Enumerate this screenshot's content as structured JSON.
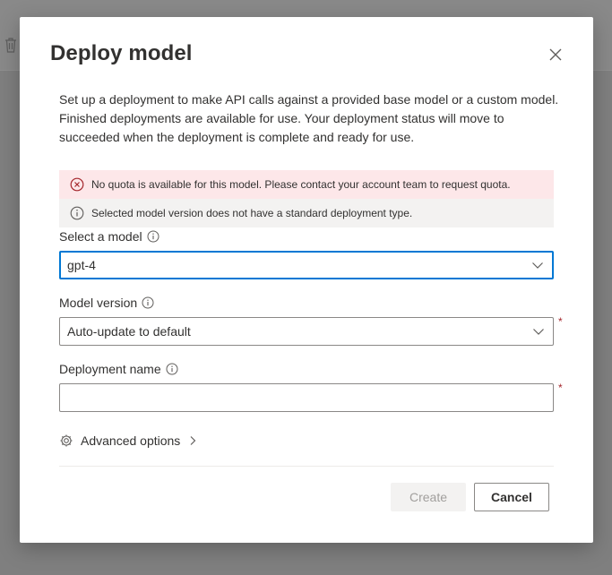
{
  "dialog": {
    "title": "Deploy model",
    "description": "Set up a deployment to make API calls against a provided base model or a custom model. Finished deployments are available for use. Your deployment status will move to succeeded when the deployment is complete and ready for use."
  },
  "messages": {
    "error": "No quota is available for this model. Please contact your account team to request quota.",
    "info": "Selected model version does not have a standard deployment type."
  },
  "form": {
    "model_label": "Select a model",
    "model_value": "gpt-4",
    "version_label": "Model version",
    "version_value": "Auto-update to default",
    "name_label": "Deployment name",
    "name_value": "",
    "required_marker": "*"
  },
  "advanced": {
    "label": "Advanced options"
  },
  "footer": {
    "create_label": "Create",
    "cancel_label": "Cancel"
  },
  "colors": {
    "accent": "#0078d4",
    "error_bg": "#fde7e9",
    "error_icon": "#a4262c",
    "info_bg": "#f3f2f1",
    "overlay": "#7f7f7f"
  },
  "icons": {
    "close": "close-icon",
    "error": "error-circle-icon",
    "info": "info-icon",
    "chevron": "chevron-down-icon",
    "gear": "gear-icon",
    "chevron_right": "chevron-right-icon",
    "trash": "trash-icon"
  }
}
